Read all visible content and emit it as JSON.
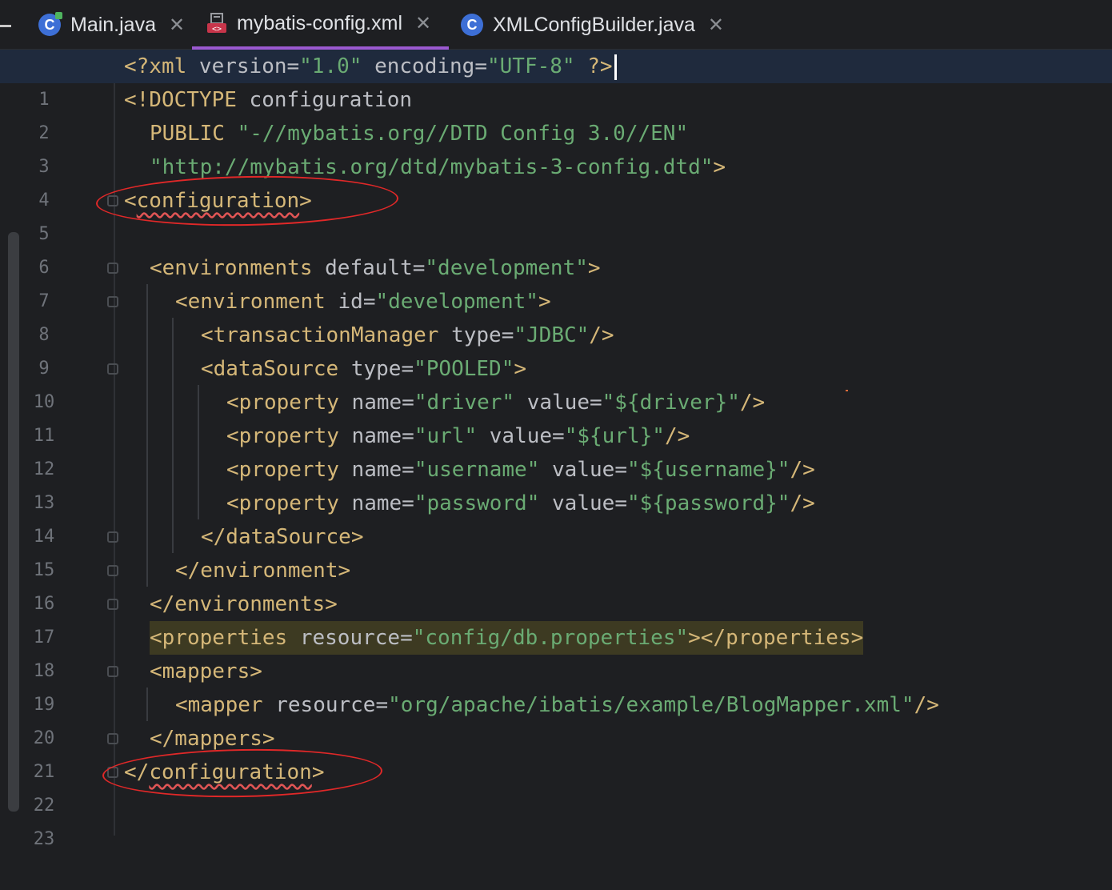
{
  "tabs": [
    {
      "label": "Main.java",
      "icon": "class-run-icon",
      "letter": "C",
      "active": false,
      "close": "✕"
    },
    {
      "label": "mybatis-config.xml",
      "icon": "xml-file-icon",
      "active": true,
      "close": "✕"
    },
    {
      "label": "XMLConfigBuilder.java",
      "icon": "class-icon",
      "letter": "C",
      "active": false,
      "close": "✕"
    }
  ],
  "editor": {
    "line_numbers": [
      "1",
      "2",
      "3",
      "4",
      "5",
      "6",
      "7",
      "8",
      "9",
      "10",
      "11",
      "12",
      "13",
      "14",
      "15",
      "16",
      "17",
      "18",
      "19",
      "20",
      "21",
      "22",
      "23"
    ],
    "lines": {
      "l1": {
        "a": "<?xml ",
        "b": "version",
        "c": "=",
        "d": "\"1.0\"",
        "e": " ",
        "f": "encoding",
        "g": "=",
        "h": "\"UTF-8\"",
        "i": " ?>"
      },
      "l2": {
        "a": "<!DOCTYPE ",
        "b": "configuration"
      },
      "l3": {
        "a": "PUBLIC ",
        "b": "\"-//mybatis.org//DTD Config 3.0//EN\""
      },
      "l4": {
        "a": "\"http://mybatis.org/dtd/mybatis-3-config.dtd\"",
        "b": ">"
      },
      "l5": {
        "a": "<",
        "b": "configuration",
        "c": ">"
      },
      "l7": {
        "a": "<environments ",
        "b": "default",
        "c": "=",
        "d": "\"development\"",
        "e": ">"
      },
      "l8": {
        "a": "<environment ",
        "b": "id",
        "c": "=",
        "d": "\"development\"",
        "e": ">"
      },
      "l9": {
        "a": "<transactionManager ",
        "b": "type",
        "c": "=",
        "d": "\"JDBC\"",
        "e": "/>"
      },
      "l10": {
        "a": "<dataSource ",
        "b": "type",
        "c": "=",
        "d": "\"POOLED\"",
        "e": ">"
      },
      "l11": {
        "a": "<property ",
        "b": "name",
        "c": "=",
        "d": "\"driver\"",
        "e": " ",
        "f": "value",
        "g": "=",
        "h": "\"${driver}\"",
        "i": "/>"
      },
      "l12": {
        "a": "<property ",
        "b": "name",
        "c": "=",
        "d": "\"url\"",
        "e": " ",
        "f": "value",
        "g": "=",
        "h": "\"${url}\"",
        "i": "/>"
      },
      "l13": {
        "a": "<property ",
        "b": "name",
        "c": "=",
        "d": "\"username\"",
        "e": " ",
        "f": "value",
        "g": "=",
        "h": "\"${username}\"",
        "i": "/>"
      },
      "l14": {
        "a": "<property ",
        "b": "name",
        "c": "=",
        "d": "\"password\"",
        "e": " ",
        "f": "value",
        "g": "=",
        "h": "\"${password}\"",
        "i": "/>"
      },
      "l15": {
        "a": "</dataSource>"
      },
      "l16": {
        "a": "</environment>"
      },
      "l17": {
        "a": "</environments>"
      },
      "l18": {
        "a": "<properties ",
        "b": "resource",
        "c": "=",
        "d": "\"config/db.properties\"",
        "e": "></properties>"
      },
      "l19": {
        "a": "<mappers>"
      },
      "l20": {
        "a": "<mapper ",
        "b": "resource",
        "c": "=",
        "d": "\"org/apache/ibatis/example/BlogMapper.xml\"",
        "e": "/>"
      },
      "l21": {
        "a": "</mappers>"
      },
      "l22": {
        "a": "</",
        "b": "configuration",
        "c": ">"
      }
    }
  },
  "colors": {
    "background": "#1e1f22",
    "tag": "#d5b778",
    "string": "#6aab73",
    "attribute": "#bcbec4",
    "active_tab_underline": "#9b59d0",
    "annotation_circle": "#e02828",
    "properties_highlight": "#3d3a22"
  }
}
